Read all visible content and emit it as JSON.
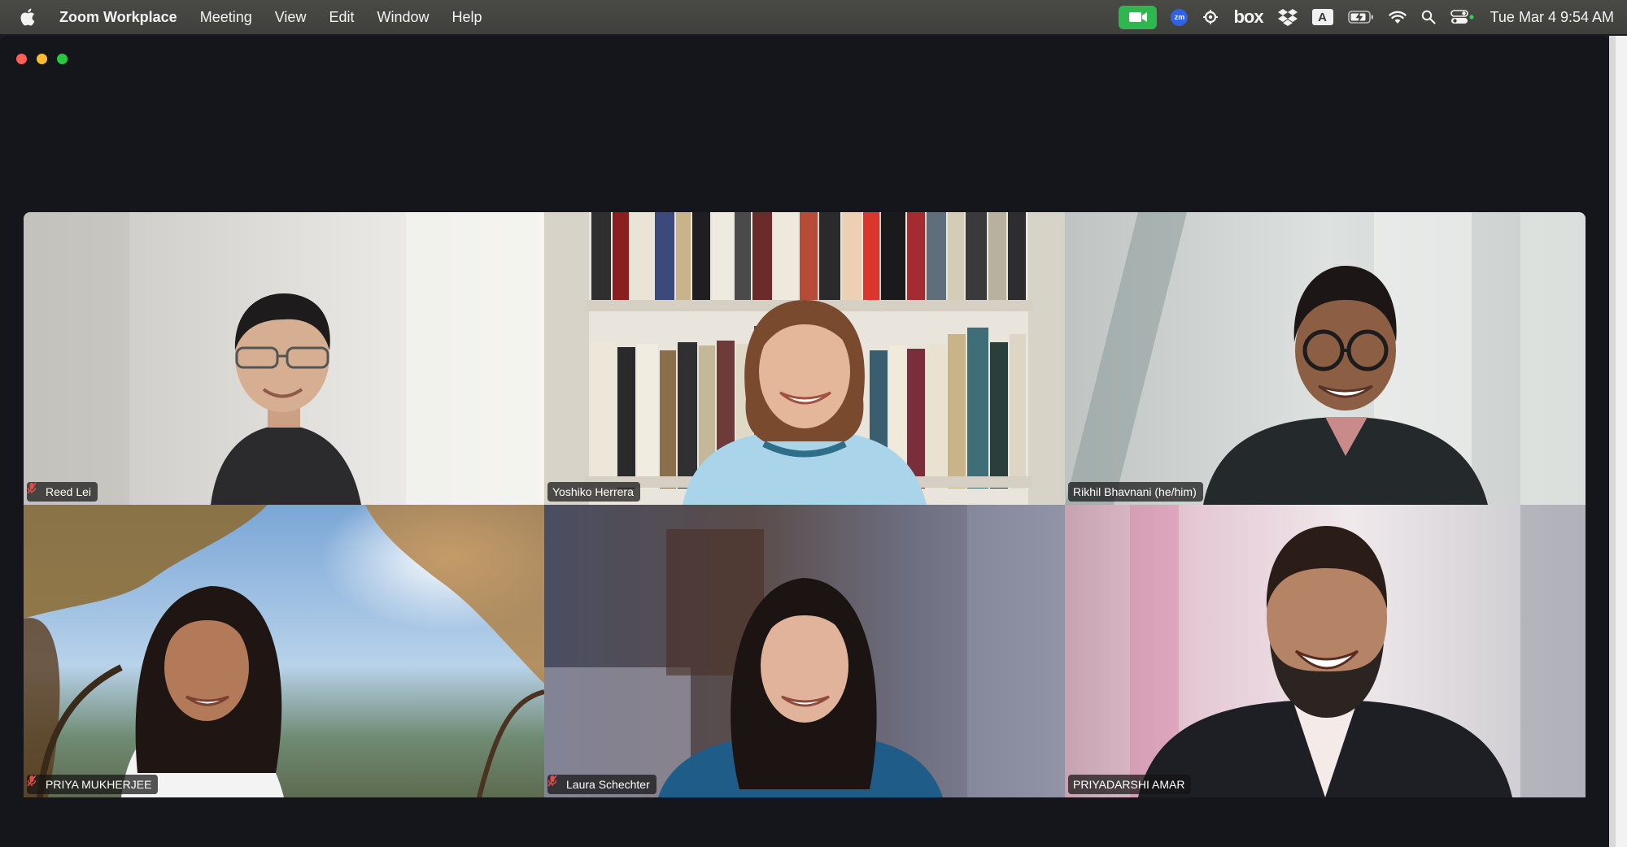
{
  "menubar": {
    "app_name": "Zoom Workplace",
    "menus": [
      "Meeting",
      "View",
      "Edit",
      "Window",
      "Help"
    ],
    "status_icons": [
      "zoom-video-icon",
      "zm-icon",
      "sync-icon",
      "box-icon",
      "dropbox-icon",
      "input-source-icon",
      "battery-icon",
      "wifi-icon",
      "spotlight-icon",
      "control-center-icon"
    ],
    "zm_label": "zm",
    "box_label": "box",
    "input_source_label": "A",
    "clock": "Tue Mar 4  9:54 AM"
  },
  "window": {
    "active_speaker_color": "#2fb64e"
  },
  "participants": [
    {
      "name": "Reed Lei",
      "muted": true,
      "active": false
    },
    {
      "name": "Yoshiko Herrera",
      "muted": false,
      "active": true
    },
    {
      "name": "Rikhil Bhavnani (he/him)",
      "muted": false,
      "active": false
    },
    {
      "name": "PRIYA MUKHERJEE",
      "muted": true,
      "active": false
    },
    {
      "name": "Laura Schechter",
      "muted": true,
      "active": false
    },
    {
      "name": "PRIYADARSHI AMAR",
      "muted": false,
      "active": false
    }
  ]
}
